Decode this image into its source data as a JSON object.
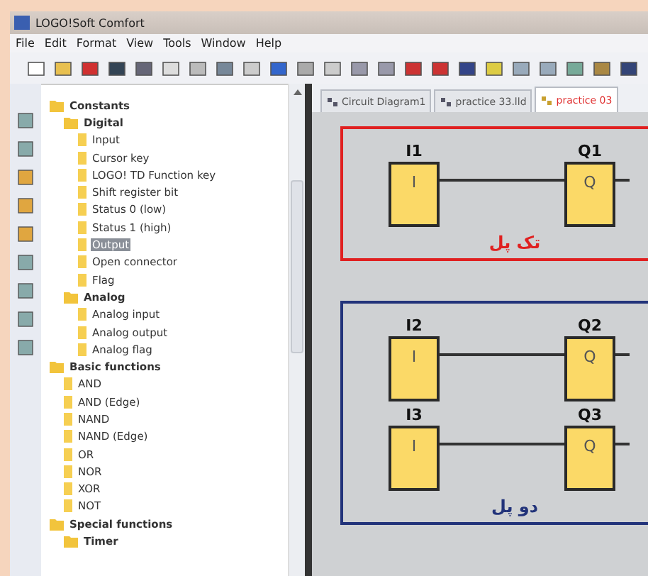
{
  "window": {
    "title": "LOGO!Soft Comfort"
  },
  "menu": [
    "File",
    "Edit",
    "Format",
    "View",
    "Tools",
    "Window",
    "Help"
  ],
  "tabs": [
    {
      "label": "Circuit Diagram1",
      "selected": false
    },
    {
      "label": "practice 33.lld",
      "selected": false
    },
    {
      "label": "practice 03",
      "selected": true
    }
  ],
  "tree": [
    {
      "label": "Constants",
      "kind": "folder",
      "selected": false,
      "children": [
        {
          "label": "Digital",
          "kind": "folder",
          "selected": false,
          "children": [
            {
              "label": "Input",
              "kind": "item",
              "selected": false
            },
            {
              "label": "Cursor key",
              "kind": "item",
              "selected": false
            },
            {
              "label": "LOGO! TD Function key",
              "kind": "item",
              "selected": false
            },
            {
              "label": "Shift register bit",
              "kind": "item",
              "selected": false
            },
            {
              "label": "Status 0 (low)",
              "kind": "item",
              "selected": false
            },
            {
              "label": "Status 1 (high)",
              "kind": "item",
              "selected": false
            },
            {
              "label": "Output",
              "kind": "item",
              "selected": true
            },
            {
              "label": "Open connector",
              "kind": "item",
              "selected": false
            },
            {
              "label": "Flag",
              "kind": "item",
              "selected": false
            }
          ]
        },
        {
          "label": "Analog",
          "kind": "folder",
          "selected": false,
          "children": [
            {
              "label": "Analog input",
              "kind": "item",
              "selected": false
            },
            {
              "label": "Analog output",
              "kind": "item",
              "selected": false
            },
            {
              "label": "Analog flag",
              "kind": "item",
              "selected": false
            }
          ]
        }
      ]
    },
    {
      "label": "Basic functions",
      "kind": "folder",
      "selected": false,
      "children": [
        {
          "label": "AND",
          "kind": "item",
          "selected": false
        },
        {
          "label": "AND (Edge)",
          "kind": "item",
          "selected": false
        },
        {
          "label": "NAND",
          "kind": "item",
          "selected": false
        },
        {
          "label": "NAND (Edge)",
          "kind": "item",
          "selected": false
        },
        {
          "label": "OR",
          "kind": "item",
          "selected": false
        },
        {
          "label": "NOR",
          "kind": "item",
          "selected": false
        },
        {
          "label": "XOR",
          "kind": "item",
          "selected": false
        },
        {
          "label": "NOT",
          "kind": "item",
          "selected": false
        }
      ]
    },
    {
      "label": "Special functions",
      "kind": "folder",
      "selected": false,
      "children": [
        {
          "label": "Timer",
          "kind": "folder",
          "selected": false
        }
      ]
    }
  ],
  "circuits": [
    {
      "color": "#e02020",
      "caption": "تک پل",
      "rungs": [
        {
          "input": "I1",
          "input_symbol": "I",
          "output": "Q1",
          "output_symbol": "Q"
        }
      ]
    },
    {
      "color": "#22337a",
      "caption": "دو پل",
      "rungs": [
        {
          "input": "I2",
          "input_symbol": "I",
          "output": "Q2",
          "output_symbol": "Q"
        },
        {
          "input": "I3",
          "input_symbol": "I",
          "output": "Q3",
          "output_symbol": "Q"
        }
      ]
    }
  ]
}
